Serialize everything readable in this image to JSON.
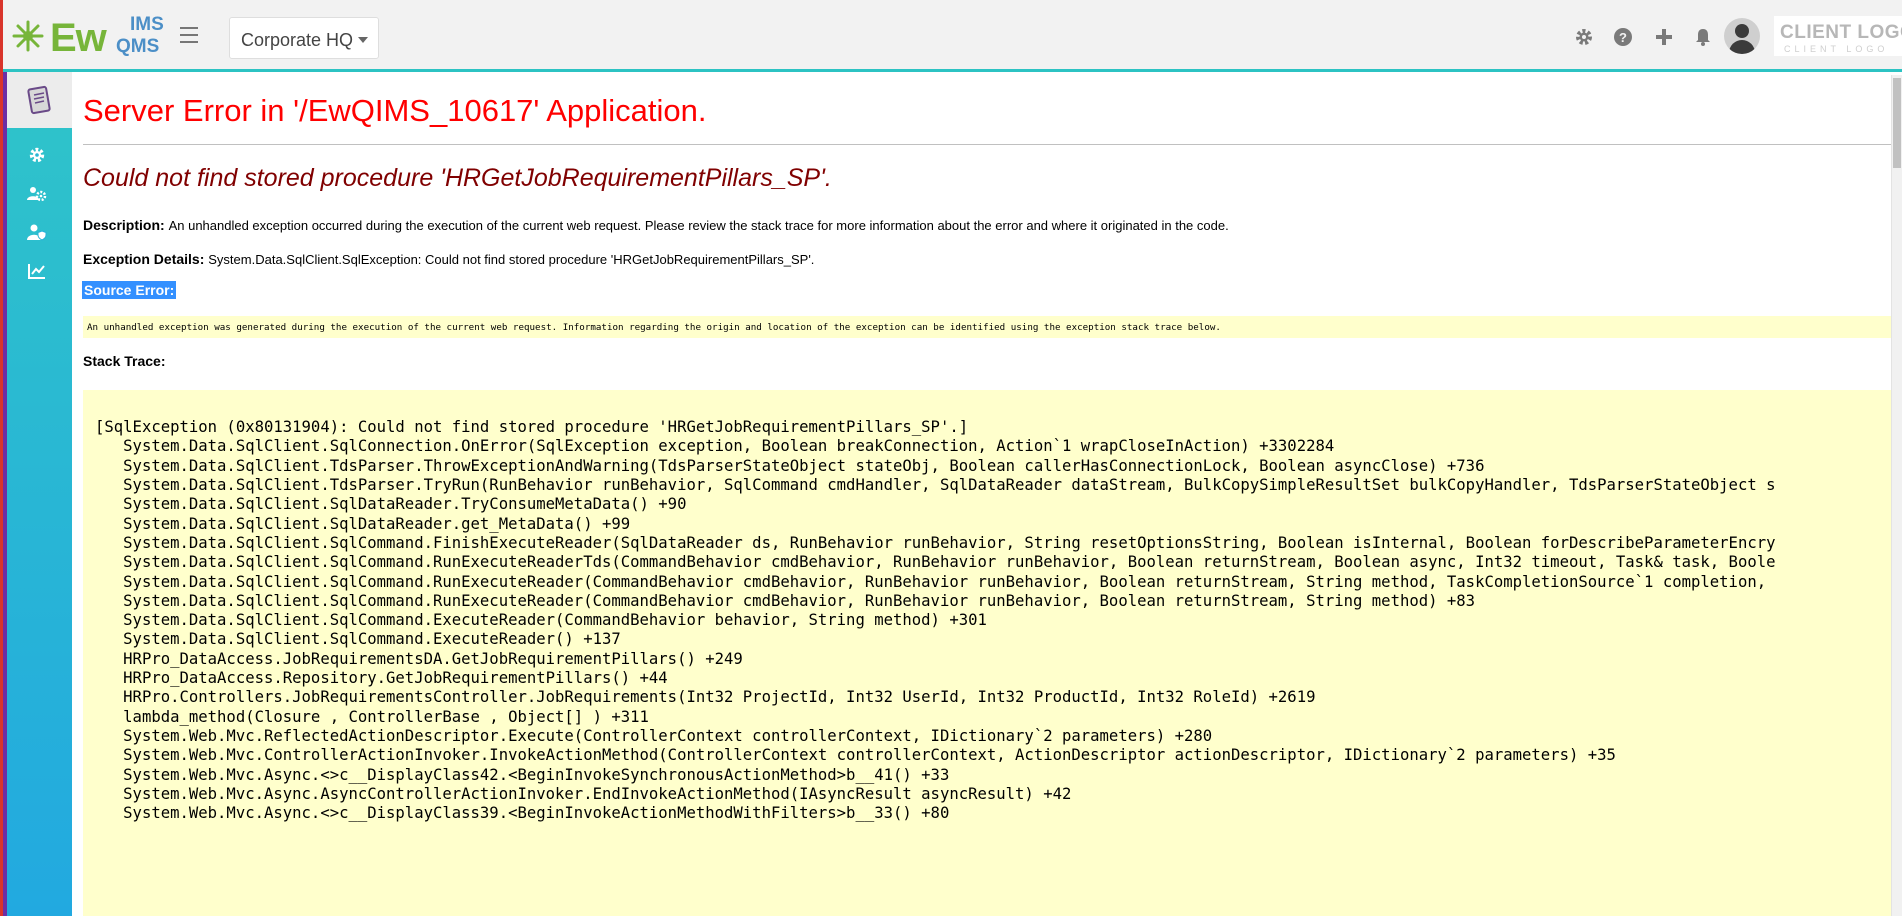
{
  "header": {
    "logo_main": "Ew",
    "logo_ims": "IMS",
    "logo_qms": "QMS",
    "site_selector": "Corporate HQ",
    "client_logo": "CLIENT LOGO",
    "client_logo_sub": "CLIENT LOGO"
  },
  "error": {
    "title": "Server Error in '/EwQIMS_10617' Application.",
    "message": "Could not find stored procedure 'HRGetJobRequirementPillars_SP'.",
    "description_label": "Description:",
    "description_text": "An unhandled exception occurred during the execution of the current web request. Please review the stack trace for more information about the error and where it originated in the code.",
    "exception_label": "Exception Details:",
    "exception_text": "System.Data.SqlClient.SqlException: Could not find stored procedure 'HRGetJobRequirementPillars_SP'.",
    "source_error_label": "Source Error:",
    "source_error_text": "An unhandled exception was generated during the execution of the current web request. Information regarding the origin and location of the exception can be identified using the exception stack trace below.",
    "stack_trace_label": "Stack Trace:"
  },
  "stack_trace": [
    "[SqlException (0x80131904): Could not find stored procedure 'HRGetJobRequirementPillars_SP'.]",
    "   System.Data.SqlClient.SqlConnection.OnError(SqlException exception, Boolean breakConnection, Action`1 wrapCloseInAction) +3302284",
    "   System.Data.SqlClient.TdsParser.ThrowExceptionAndWarning(TdsParserStateObject stateObj, Boolean callerHasConnectionLock, Boolean asyncClose) +736",
    "   System.Data.SqlClient.TdsParser.TryRun(RunBehavior runBehavior, SqlCommand cmdHandler, SqlDataReader dataStream, BulkCopySimpleResultSet bulkCopyHandler, TdsParserStateObject s",
    "   System.Data.SqlClient.SqlDataReader.TryConsumeMetaData() +90",
    "   System.Data.SqlClient.SqlDataReader.get_MetaData() +99",
    "   System.Data.SqlClient.SqlCommand.FinishExecuteReader(SqlDataReader ds, RunBehavior runBehavior, String resetOptionsString, Boolean isInternal, Boolean forDescribeParameterEncry",
    "   System.Data.SqlClient.SqlCommand.RunExecuteReaderTds(CommandBehavior cmdBehavior, RunBehavior runBehavior, Boolean returnStream, Boolean async, Int32 timeout, Task& task, Boole",
    "   System.Data.SqlClient.SqlCommand.RunExecuteReader(CommandBehavior cmdBehavior, RunBehavior runBehavior, Boolean returnStream, String method, TaskCompletionSource`1 completion,",
    "   System.Data.SqlClient.SqlCommand.RunExecuteReader(CommandBehavior cmdBehavior, RunBehavior runBehavior, Boolean returnStream, String method) +83",
    "   System.Data.SqlClient.SqlCommand.ExecuteReader(CommandBehavior behavior, String method) +301",
    "   System.Data.SqlClient.SqlCommand.ExecuteReader() +137",
    "   HRPro_DataAccess.JobRequirementsDA.GetJobRequirementPillars() +249",
    "   HRPro_DataAccess.Repository.GetJobRequirementPillars() +44",
    "   HRPro.Controllers.JobRequirementsController.JobRequirements(Int32 ProjectId, Int32 UserId, Int32 ProductId, Int32 RoleId) +2619",
    "   lambda_method(Closure , ControllerBase , Object[] ) +311",
    "   System.Web.Mvc.ReflectedActionDescriptor.Execute(ControllerContext controllerContext, IDictionary`2 parameters) +280",
    "   System.Web.Mvc.ControllerActionInvoker.InvokeActionMethod(ControllerContext controllerContext, ActionDescriptor actionDescriptor, IDictionary`2 parameters) +35",
    "   System.Web.Mvc.Async.<>c__DisplayClass42.<BeginInvokeSynchronousActionMethod>b__41() +33",
    "   System.Web.Mvc.Async.AsyncControllerActionInvoker.EndInvokeActionMethod(IAsyncResult asyncResult) +42",
    "   System.Web.Mvc.Async.<>c__DisplayClass39.<BeginInvokeActionMethodWithFilters>b__33() +80"
  ],
  "colors": {
    "error_title": "#ff0000",
    "error_message": "#800000",
    "code_background": "#ffffcc",
    "sidebar": "#22a9e0",
    "header_accent": "#2cc3c3"
  },
  "icons": {
    "header": [
      "gear-icon",
      "help-icon",
      "plus-icon",
      "bell-icon",
      "avatar"
    ],
    "sidebar": [
      "document-icon",
      "settings-icon",
      "users-cog-icon",
      "user-shield-icon",
      "chart-line-icon"
    ]
  }
}
